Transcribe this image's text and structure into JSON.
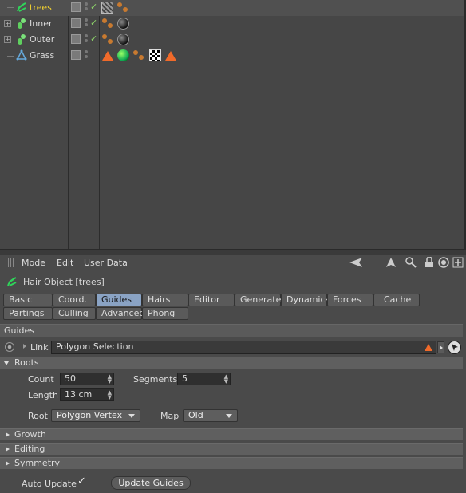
{
  "objects": [
    {
      "name": "trees",
      "icon": "hair-icon",
      "highlighted": true
    },
    {
      "name": "Inner",
      "icon": "cloner-icon",
      "highlighted": false
    },
    {
      "name": "Outer",
      "icon": "cloner-icon",
      "highlighted": false
    },
    {
      "name": "Grass",
      "icon": "polygon-icon",
      "highlighted": false
    }
  ],
  "menu": {
    "mode": "Mode",
    "edit": "Edit",
    "user_data": "User Data"
  },
  "object_title": "Hair Object [trees]",
  "tabs_row1": [
    "Basic",
    "Coord.",
    "Guides",
    "Hairs",
    "Editor",
    "Generate",
    "Dynamics",
    "Forces",
    "Cache"
  ],
  "tabs_row2": [
    "Partings",
    "Culling",
    "Advanced",
    "Phong"
  ],
  "active_tab": "Guides",
  "section_title": "Guides",
  "link": {
    "label": "Link",
    "value": "Polygon Selection"
  },
  "roots": {
    "title": "Roots",
    "count_label": "Count",
    "count": "50",
    "segments_label": "Segments",
    "segments": "5",
    "length_label": "Length",
    "length": "13 cm",
    "root_label": "Root",
    "root": "Polygon Vertex",
    "map_label": "Map",
    "map": "Old"
  },
  "collapsed_sections": [
    "Growth",
    "Editing",
    "Symmetry"
  ],
  "auto_update_label": "Auto Update",
  "auto_update_checked": true,
  "update_guides_label": "Update Guides",
  "colors": {
    "accent_tab": "#8aa3c4",
    "highlight_name": "#f0d030",
    "warning": "#f06a2a"
  }
}
